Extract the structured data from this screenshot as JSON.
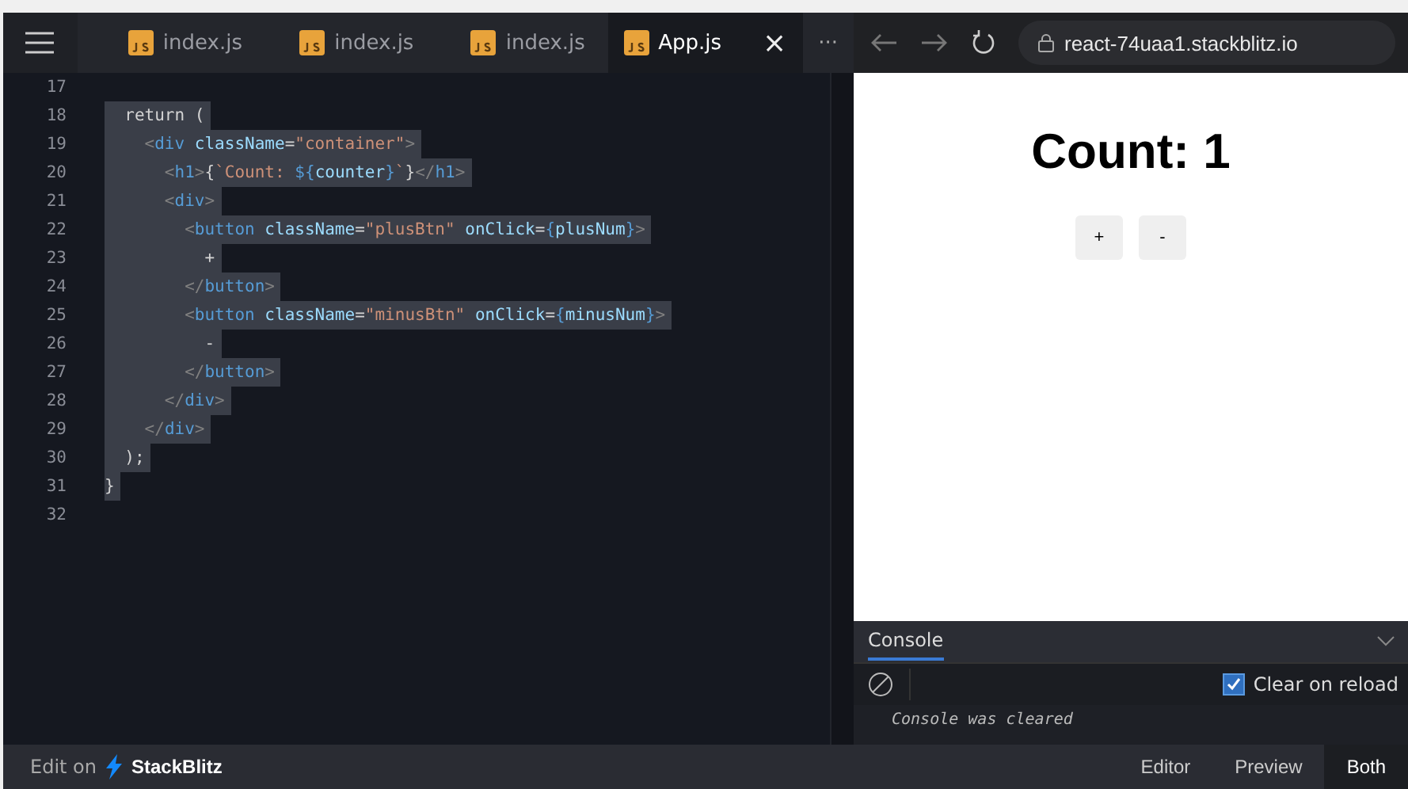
{
  "tabs": [
    {
      "label": "index.js",
      "selected": false
    },
    {
      "label": "index.js",
      "selected": false
    },
    {
      "label": "index.js",
      "selected": false
    },
    {
      "label": "App.js",
      "selected": true
    }
  ],
  "tab_close": "×",
  "tab_overflow": "···",
  "address": "react-74uaa1.stackblitz.io",
  "code_lines": [
    {
      "number": "17",
      "selected": false
    },
    {
      "number": "18",
      "selected": true,
      "tokens": [
        {
          "kind": "plain",
          "text": "  return ("
        }
      ]
    },
    {
      "number": "19",
      "selected": true,
      "tokens": [
        {
          "kind": "punct",
          "text": "    <"
        },
        {
          "kind": "tag",
          "text": "div "
        },
        {
          "kind": "attr",
          "text": "className"
        },
        {
          "kind": "plain",
          "text": "="
        },
        {
          "kind": "str",
          "text": "\"container\""
        },
        {
          "kind": "punct",
          "text": ">"
        }
      ]
    },
    {
      "number": "20",
      "selected": true,
      "tokens": [
        {
          "kind": "punct",
          "text": "      <"
        },
        {
          "kind": "tag",
          "text": "h1"
        },
        {
          "kind": "punct",
          "text": ">"
        },
        {
          "kind": "plain",
          "text": "{"
        },
        {
          "kind": "str",
          "text": "`Count: "
        },
        {
          "kind": "tag",
          "text": "${"
        },
        {
          "kind": "attr",
          "text": "counter"
        },
        {
          "kind": "tag",
          "text": "}"
        },
        {
          "kind": "str",
          "text": "`"
        },
        {
          "kind": "plain",
          "text": "}"
        },
        {
          "kind": "punct",
          "text": "</"
        },
        {
          "kind": "tag",
          "text": "h1"
        },
        {
          "kind": "punct",
          "text": ">"
        }
      ]
    },
    {
      "number": "21",
      "selected": true,
      "tokens": [
        {
          "kind": "punct",
          "text": "      <"
        },
        {
          "kind": "tag",
          "text": "div"
        },
        {
          "kind": "punct",
          "text": ">"
        }
      ]
    },
    {
      "number": "22",
      "selected": true,
      "tokens": [
        {
          "kind": "punct",
          "text": "        <"
        },
        {
          "kind": "tag",
          "text": "button "
        },
        {
          "kind": "attr",
          "text": "className"
        },
        {
          "kind": "plain",
          "text": "="
        },
        {
          "kind": "str",
          "text": "\"plusBtn\" "
        },
        {
          "kind": "attr",
          "text": "onClick"
        },
        {
          "kind": "plain",
          "text": "="
        },
        {
          "kind": "tag",
          "text": "{"
        },
        {
          "kind": "attr",
          "text": "plusNum"
        },
        {
          "kind": "tag",
          "text": "}"
        },
        {
          "kind": "punct",
          "text": ">"
        }
      ]
    },
    {
      "number": "23",
      "selected": true,
      "tokens": [
        {
          "kind": "plain",
          "text": "          +"
        }
      ]
    },
    {
      "number": "24",
      "selected": true,
      "tokens": [
        {
          "kind": "punct",
          "text": "        </"
        },
        {
          "kind": "tag",
          "text": "button"
        },
        {
          "kind": "punct",
          "text": ">"
        }
      ]
    },
    {
      "number": "25",
      "selected": true,
      "tokens": [
        {
          "kind": "punct",
          "text": "        <"
        },
        {
          "kind": "tag",
          "text": "button "
        },
        {
          "kind": "attr",
          "text": "className"
        },
        {
          "kind": "plain",
          "text": "="
        },
        {
          "kind": "str",
          "text": "\"minusBtn\" "
        },
        {
          "kind": "attr",
          "text": "onClick"
        },
        {
          "kind": "plain",
          "text": "="
        },
        {
          "kind": "tag",
          "text": "{"
        },
        {
          "kind": "attr",
          "text": "minusNum"
        },
        {
          "kind": "tag",
          "text": "}"
        },
        {
          "kind": "punct",
          "text": ">"
        }
      ]
    },
    {
      "number": "26",
      "selected": true,
      "tokens": [
        {
          "kind": "plain",
          "text": "          -"
        }
      ]
    },
    {
      "number": "27",
      "selected": true,
      "tokens": [
        {
          "kind": "punct",
          "text": "        </"
        },
        {
          "kind": "tag",
          "text": "button"
        },
        {
          "kind": "punct",
          "text": ">"
        }
      ]
    },
    {
      "number": "28",
      "selected": true,
      "tokens": [
        {
          "kind": "punct",
          "text": "      </"
        },
        {
          "kind": "tag",
          "text": "div"
        },
        {
          "kind": "punct",
          "text": ">"
        }
      ]
    },
    {
      "number": "29",
      "selected": true,
      "tokens": [
        {
          "kind": "punct",
          "text": "    </"
        },
        {
          "kind": "tag",
          "text": "div"
        },
        {
          "kind": "punct",
          "text": ">"
        }
      ]
    },
    {
      "number": "30",
      "selected": true,
      "tokens": [
        {
          "kind": "plain",
          "text": "  );"
        }
      ]
    },
    {
      "number": "31",
      "selected": true,
      "tokens": [
        {
          "kind": "plain",
          "text": "}"
        }
      ]
    },
    {
      "number": "32",
      "selected": false
    }
  ],
  "preview": {
    "heading": "Count: 1",
    "buttons": [
      "+",
      "-"
    ]
  },
  "console": {
    "title": "Console",
    "clear_on_reload": {
      "label": "Clear on reload",
      "checked": true
    },
    "message": "Console was cleared"
  },
  "footer": {
    "edit_on": "Edit on",
    "brand": "StackBlitz",
    "views": [
      {
        "label": "Editor",
        "selected": false
      },
      {
        "label": "Preview",
        "selected": false
      },
      {
        "label": "Both",
        "selected": true
      }
    ]
  }
}
